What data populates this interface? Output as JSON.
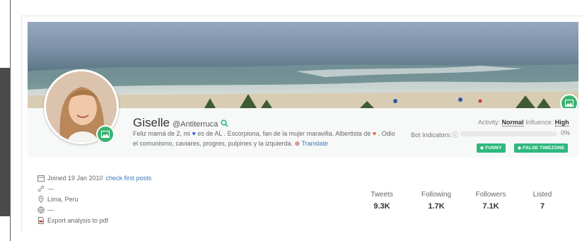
{
  "profile": {
    "name": "Giselle",
    "handle": "@Antiterruca",
    "bio_part1": "Feliz mamá de 2, mi",
    "bio_part2": "es de AL . Escorpiona, fan de la mujer maravilla, Albertista de",
    "bio_part3": ". Odio el comunismo, caviares, progres, pulpines y la izquierda.",
    "translate_label": "Translate"
  },
  "indicators": {
    "activity_label": "Activity:",
    "activity_value": "Normal",
    "influence_label": "Influence:",
    "influence_value": "High",
    "bot_label": "Bot Indicators:",
    "bot_percent": "0%",
    "tags": [
      "FUNNY",
      "FALSE TIMEZONE"
    ]
  },
  "meta": {
    "joined": "Joined 19 Jan 2010",
    "check_posts": "check first posts",
    "website": "—",
    "location": "Lima, Peru",
    "language": "—",
    "export": "Export analysis to pdf"
  },
  "stats": [
    {
      "label": "Tweets",
      "value": "9.3K"
    },
    {
      "label": "Following",
      "value": "1.7K"
    },
    {
      "label": "Followers",
      "value": "7.1K"
    },
    {
      "label": "Listed",
      "value": "7"
    }
  ],
  "colors": {
    "accent_green": "#2eb87e",
    "link_blue": "#3b7bbf"
  },
  "icons": [
    "search-icon",
    "info-icon",
    "calendar-icon",
    "link-icon",
    "location-icon",
    "globe-icon",
    "pdf-icon",
    "image-icon"
  ]
}
